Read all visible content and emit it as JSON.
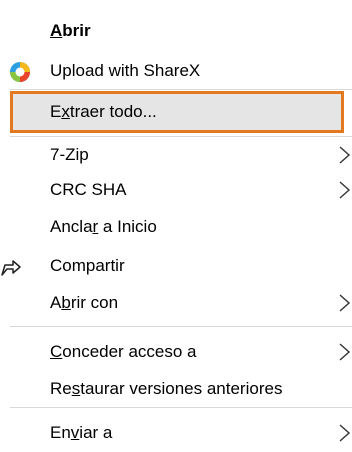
{
  "menu": {
    "items": [
      {
        "before": "",
        "key": "A",
        "after": "brir"
      },
      {
        "before": "Upload with ShareX",
        "key": "",
        "after": ""
      },
      {
        "before": "E",
        "key": "x",
        "after": "traer todo..."
      },
      {
        "before": "7-Zip",
        "key": "",
        "after": ""
      },
      {
        "before": "CRC SHA",
        "key": "",
        "after": ""
      },
      {
        "before": "Ancla",
        "key": "r",
        "after": " a Inicio"
      },
      {
        "before": "Compartir",
        "key": "",
        "after": ""
      },
      {
        "before": "A",
        "key": "b",
        "after": "rir con"
      },
      {
        "before": "",
        "key": "C",
        "after": "onceder acceso a"
      },
      {
        "before": "Re",
        "key": "s",
        "after": "taurar versiones anteriores"
      },
      {
        "before": "En",
        "key": "v",
        "after": "iar a"
      }
    ],
    "icons": {
      "upload_with_sharex": "sharex-icon",
      "compartir": "share-icon",
      "submenu": "chevron-right-icon"
    }
  },
  "colors": {
    "highlight_border": "#e3781f",
    "highlight_fill": "#e5e5e5",
    "separator": "#d9d9d9"
  }
}
